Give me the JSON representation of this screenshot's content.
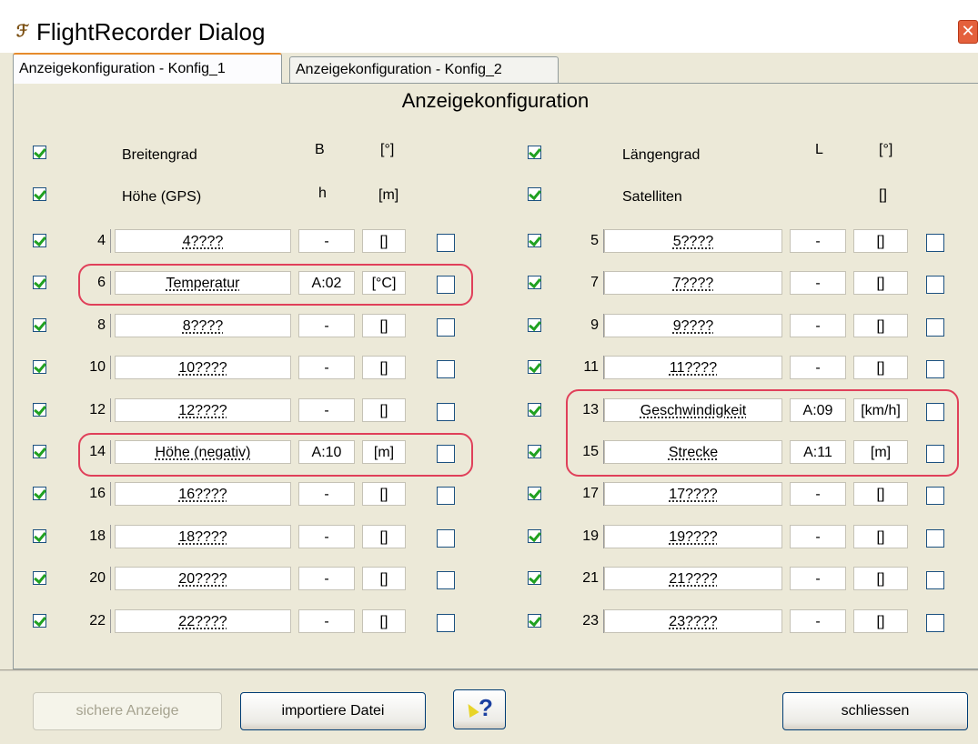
{
  "window": {
    "title": "FlightRecorder Dialog",
    "close_glyph": "✕"
  },
  "tabs": [
    {
      "label": "Anzeigekonfiguration - Konfig_1",
      "active": true
    },
    {
      "label": "Anzeigekonfiguration - Konfig_2",
      "active": false
    }
  ],
  "heading": "Anzeigekonfiguration",
  "fixed_rows": {
    "left": [
      {
        "label": "Breitengrad",
        "symbol": "B",
        "unit": "[°]",
        "checked": true
      },
      {
        "label": "Höhe (GPS)",
        "symbol": "h",
        "unit": "[m]",
        "checked": true
      }
    ],
    "right": [
      {
        "label": "Längengrad",
        "symbol": "L",
        "unit": "[°]",
        "checked": true
      },
      {
        "label": "Satelliten",
        "symbol": "",
        "unit": "[]",
        "checked": true
      }
    ]
  },
  "rows": {
    "left": [
      {
        "num": "4",
        "name": "4????",
        "channel": "-",
        "unit": "[]",
        "checked": true,
        "flag": false
      },
      {
        "num": "6",
        "name": "Temperatur",
        "channel": "A:02",
        "unit": "[°C]",
        "checked": true,
        "flag": false
      },
      {
        "num": "8",
        "name": "8????",
        "channel": "-",
        "unit": "[]",
        "checked": true,
        "flag": false
      },
      {
        "num": "10",
        "name": "10????",
        "channel": "-",
        "unit": "[]",
        "checked": true,
        "flag": false
      },
      {
        "num": "12",
        "name": "12????",
        "channel": "-",
        "unit": "[]",
        "checked": true,
        "flag": false
      },
      {
        "num": "14",
        "name": "Höhe (negativ)",
        "channel": "A:10",
        "unit": "[m]",
        "checked": true,
        "flag": false
      },
      {
        "num": "16",
        "name": "16????",
        "channel": "-",
        "unit": "[]",
        "checked": true,
        "flag": false
      },
      {
        "num": "18",
        "name": "18????",
        "channel": "-",
        "unit": "[]",
        "checked": true,
        "flag": false
      },
      {
        "num": "20",
        "name": "20????",
        "channel": "-",
        "unit": "[]",
        "checked": true,
        "flag": false
      },
      {
        "num": "22",
        "name": "22????",
        "channel": "-",
        "unit": "[]",
        "checked": true,
        "flag": false
      }
    ],
    "right": [
      {
        "num": "5",
        "name": "5????",
        "channel": "-",
        "unit": "[]",
        "checked": true,
        "flag": false
      },
      {
        "num": "7",
        "name": "7????",
        "channel": "-",
        "unit": "[]",
        "checked": true,
        "flag": false
      },
      {
        "num": "9",
        "name": "9????",
        "channel": "-",
        "unit": "[]",
        "checked": true,
        "flag": false
      },
      {
        "num": "11",
        "name": "11????",
        "channel": "-",
        "unit": "[]",
        "checked": true,
        "flag": false
      },
      {
        "num": "13",
        "name": "Geschwindigkeit",
        "channel": "A:09",
        "unit": "[km/h]",
        "checked": true,
        "flag": false
      },
      {
        "num": "15",
        "name": "Strecke",
        "channel": "A:11",
        "unit": "[m]",
        "checked": true,
        "flag": false
      },
      {
        "num": "17",
        "name": "17????",
        "channel": "-",
        "unit": "[]",
        "checked": true,
        "flag": false
      },
      {
        "num": "19",
        "name": "19????",
        "channel": "-",
        "unit": "[]",
        "checked": true,
        "flag": false
      },
      {
        "num": "21",
        "name": "21????",
        "channel": "-",
        "unit": "[]",
        "checked": true,
        "flag": false
      },
      {
        "num": "23",
        "name": "23????",
        "channel": "-",
        "unit": "[]",
        "checked": true,
        "flag": false
      }
    ]
  },
  "buttons": {
    "save": "sichere Anzeige",
    "import": "importiere Datei",
    "help": "?",
    "close": "schliessen"
  },
  "icons": {
    "app": "flight-recorder-app-icon",
    "help": "help-pointer-icon"
  },
  "colors": {
    "highlight": "#e0405a",
    "check": "#21a121",
    "dialog_bg": "#ece9d8"
  }
}
